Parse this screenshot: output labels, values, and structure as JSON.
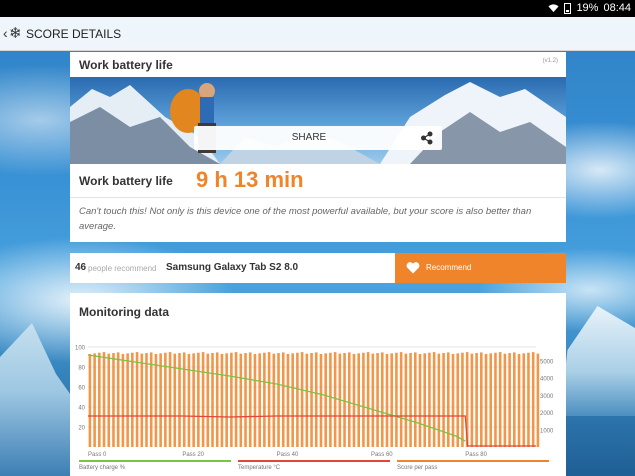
{
  "status_bar": {
    "battery": "19%",
    "time": "08:44"
  },
  "app_bar": {
    "title": "SCORE DETAILS"
  },
  "result_card": {
    "title": "Work battery life",
    "version": "(v1.2)",
    "share_label": "SHARE",
    "score_label": "Work battery life",
    "score_value": "9 h 13 min",
    "description": "Can't touch this! Not only is this device one of the most powerful available, but your score is also better than average."
  },
  "recommend": {
    "count": "46",
    "text": "people recommend",
    "device": "Samsung Galaxy Tab S2 8.0",
    "button_label": "Recommend"
  },
  "monitoring": {
    "title": "Monitoring data",
    "chart_data": {
      "type": "bar",
      "left_axis_ticks": [
        "100",
        "80",
        "60",
        "40",
        "20"
      ],
      "right_axis_ticks": [
        "5000",
        "4000",
        "3000",
        "2000",
        "1000"
      ],
      "x_ticks": [
        "Pass 0",
        "Pass 20",
        "Pass 40",
        "Pass 60",
        "Pass 80"
      ],
      "x_range": [
        0,
        95
      ],
      "left_range": [
        0,
        100
      ],
      "right_range": [
        0,
        5800
      ],
      "score_series": {
        "name": "Score per pass",
        "color": "#f0842a",
        "start_pass": 0,
        "end_pass": 95,
        "approx_value": 5450
      },
      "battery_series": {
        "name": "Battery charge %",
        "color": "#7cc243",
        "points": [
          [
            0,
            92
          ],
          [
            10,
            85
          ],
          [
            20,
            78
          ],
          [
            30,
            71
          ],
          [
            40,
            63
          ],
          [
            50,
            52
          ],
          [
            60,
            38
          ],
          [
            70,
            24
          ],
          [
            78,
            11
          ],
          [
            80,
            6
          ]
        ]
      },
      "temperature_series": {
        "name": "Temperature °C",
        "color": "#e0463a",
        "points": [
          [
            0,
            31
          ],
          [
            20,
            31
          ],
          [
            30,
            30
          ],
          [
            40,
            31
          ],
          [
            50,
            31
          ],
          [
            60,
            31
          ],
          [
            70,
            31
          ],
          [
            80,
            31
          ],
          [
            80.5,
            1
          ],
          [
            95,
            1
          ]
        ]
      },
      "legend": [
        "Battery charge %",
        "Temperature °C",
        "Score per pass"
      ]
    }
  }
}
